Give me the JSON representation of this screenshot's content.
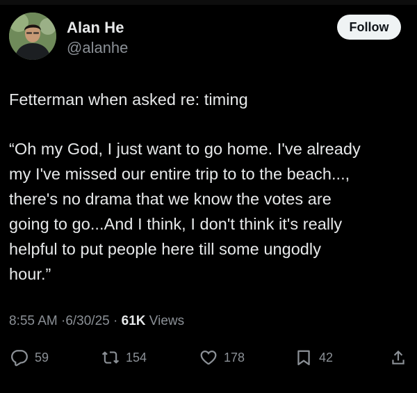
{
  "author": {
    "name": "Alan He",
    "handle": "@alanhe"
  },
  "follow_label": "Follow",
  "tweet_lines": [
    "Fetterman when asked re: timing",
    "“Oh my God, I just want to go home. I've already",
    "my I've missed our entire trip to to the beach...,",
    "there's no drama that we know the votes are",
    "going to go...And I think, I don't think it's really",
    "helpful to put people here till some ungodly",
    "hour.”"
  ],
  "meta": {
    "time": "8:55 AM",
    "date": "6/30/25",
    "views_count": "61K",
    "views_label": "Views",
    "separator": "·"
  },
  "actions": {
    "replies": "59",
    "reposts": "154",
    "likes": "178",
    "bookmarks": "42"
  },
  "icons": [
    "reply-icon",
    "repost-icon",
    "like-icon",
    "bookmark-icon",
    "share-icon"
  ],
  "colors": {
    "background": "#000000",
    "text": "#e7e9ea",
    "muted": "#8b9096",
    "follow_bg": "#eff3f4"
  }
}
